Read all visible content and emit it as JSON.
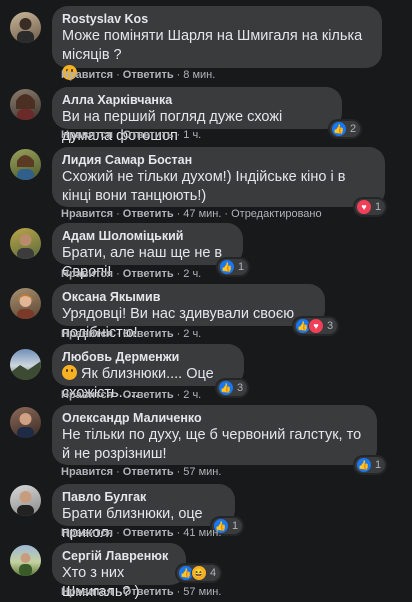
{
  "labels": {
    "like": "Нравится",
    "reply": "Ответить",
    "edited": "Отредактировано"
  },
  "comments": [
    {
      "name": "Rostyslav Kos",
      "text": "Може поміняти Шарля на Шмигаля на кілька місяців ?",
      "time": "8 мин."
    },
    {
      "name": "Алла Харківчанка",
      "text": "Ви на перший погляд дуже схожі думала фотошоп",
      "time": "1 ч.",
      "reactions": "2"
    },
    {
      "name": "Лидия Самар Бостан",
      "text": "Схожий не тільки духом!) Індійське кіно і в кінці вони танцюють!)",
      "time": "47 мин.",
      "reactions": "1"
    },
    {
      "name": "Адам Шоломіцький",
      "text": "Брати, але наш ще не в Європі!",
      "time": "2 ч.",
      "reactions": "1"
    },
    {
      "name": "Оксана Якымив",
      "text": "Урядовці! Ви нас здивували своєю подібністю!",
      "time": "2 ч.",
      "reactions": "3"
    },
    {
      "name": "Любовь Дерменжи",
      "text": "Як близнюки.... Оце схожість.....",
      "time": "2 ч.",
      "reactions": "3"
    },
    {
      "name": "Олександр Маличенко",
      "text": "Не тільки по духу, ще б червоний галстук, то й не розрізниш!",
      "time": "57 мин.",
      "reactions": "1"
    },
    {
      "name": "Павло Булгак",
      "text": "Брати близнюки, оце прикол.",
      "time": "41 мин.",
      "reactions": "1"
    },
    {
      "name": "Сергій Лавренюк",
      "text": "Хто з них Шмигаль? )",
      "time": "57 мин.",
      "reactions": "4"
    }
  ],
  "colors": {
    "background": "#18191a",
    "bubble": "#3a3b3c",
    "like": "#1877f2",
    "love": "#f33e58",
    "haha": "#f7b125"
  }
}
